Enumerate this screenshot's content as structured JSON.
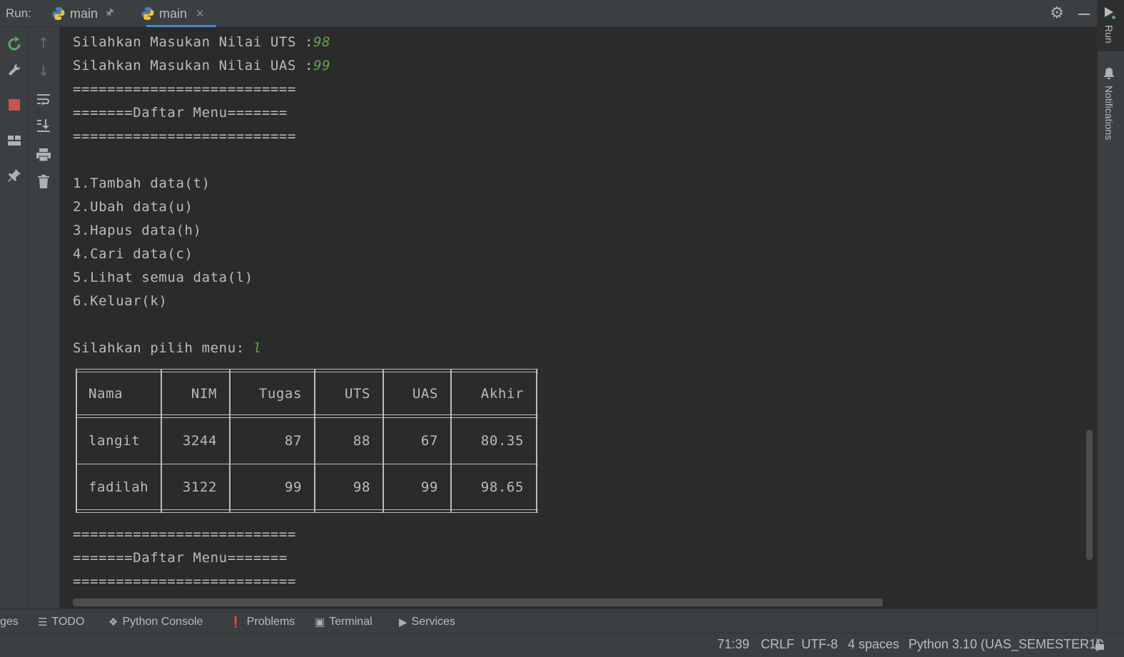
{
  "run_bar": {
    "label": "Run:",
    "tabs": [
      {
        "label": "main",
        "pinned": true
      },
      {
        "label": "main",
        "active": true
      }
    ],
    "icons": [
      "settings-gear-icon",
      "minimize-icon"
    ]
  },
  "right_strip": {
    "run_label": "Run",
    "notifications_label": "Notifications"
  },
  "console": {
    "lines": [
      {
        "text": "Silahkan Masukan Nilai UTS :",
        "input": "98"
      },
      {
        "text": "Silahkan Masukan Nilai UAS :",
        "input": "99"
      },
      {
        "text": "=========================="
      },
      {
        "text": "=======Daftar Menu======="
      },
      {
        "text": "=========================="
      },
      {
        "text": "1.Tambah data(t)"
      },
      {
        "text": "2.Ubah data(u)"
      },
      {
        "text": "3.Hapus data(h)"
      },
      {
        "text": "4.Cari data(c)"
      },
      {
        "text": "5.Lihat semua data(l)"
      },
      {
        "text": "6.Keluar(k)"
      },
      {
        "text": "Silahkan pilih menu: ",
        "input": "l"
      },
      {
        "text": "=========================="
      },
      {
        "text": "=======Daftar Menu======="
      },
      {
        "text": "=========================="
      }
    ],
    "table": {
      "headers": [
        "Nama",
        "NIM",
        "Tugas",
        "UTS",
        "UAS",
        "Akhir"
      ],
      "rows": [
        [
          "langit",
          "3244",
          "87",
          "88",
          "67",
          "80.35"
        ],
        [
          "fadilah",
          "3122",
          "99",
          "98",
          "99",
          "98.65"
        ]
      ]
    }
  },
  "bottom_tabs": [
    {
      "label": "ges",
      "icon": "none"
    },
    {
      "label": "TODO",
      "icon": "list-icon"
    },
    {
      "label": "Python Console",
      "icon": "python-console-icon"
    },
    {
      "label": "Problems",
      "icon": "problems-icon"
    },
    {
      "label": "Terminal",
      "icon": "terminal-icon"
    },
    {
      "label": "Services",
      "icon": "services-icon"
    }
  ],
  "status_bar": {
    "position": "71:39",
    "line_separator": "CRLF",
    "encoding": "UTF-8",
    "indent": "4 spaces",
    "interpreter": "Python 3.10 (UAS_SEMESTER1)"
  },
  "colors": {
    "background": "#2b2b2b",
    "panel": "#3c3f41",
    "text": "#bbbbbb",
    "input": "#62a548",
    "accent": "#4a88c7",
    "stop": "#c75450",
    "rerun": "#59a869"
  }
}
